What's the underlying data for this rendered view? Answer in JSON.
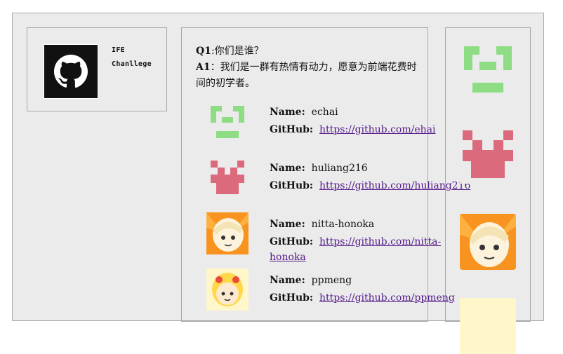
{
  "sidebar": {
    "brand_line1": "IFE",
    "brand_line2": "Chanllege"
  },
  "qa": {
    "q_label": "Q1",
    "q_text": ":你们是谁？",
    "a_label": "A1",
    "a_text": "：我们是一群有热情有动力，愿意为前端花费时间的初学者。"
  },
  "labels": {
    "name": "Name:",
    "github": "GitHub:"
  },
  "members": [
    {
      "name": "echai",
      "url": "https://github.com/ehai",
      "avatar_icon": "green-identicon"
    },
    {
      "name": "huliang216",
      "url": "https://github.com/huliang216",
      "avatar_icon": "red-identicon"
    },
    {
      "name": "nitta-honoka",
      "url_line1": "https://github.com/nitta-",
      "url_line2": "honoka",
      "avatar_icon": "anime-girl-avatar"
    },
    {
      "name": "ppmeng",
      "url": "https://github.com/ppmeng",
      "avatar_icon": "anime-girl-yellow-avatar"
    }
  ],
  "colors": {
    "panel_bg": "#ebebeb",
    "border": "#a8a8a8",
    "link": "#551a8b",
    "identicon_green": "#8edc83",
    "identicon_red": "#db6a7d"
  }
}
